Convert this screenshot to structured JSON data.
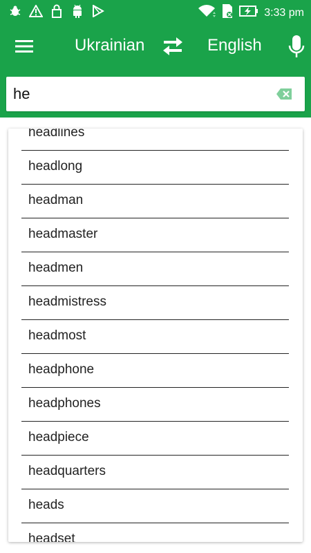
{
  "status_bar": {
    "time": "3:33 pm",
    "left_icons": [
      "bug-icon",
      "warning-triangle-icon",
      "lock-icon",
      "android-icon",
      "play-store-icon"
    ],
    "right_icons": [
      "wifi-icon",
      "sim-card-icon",
      "battery-charging-icon"
    ]
  },
  "toolbar": {
    "source_language": "Ukrainian",
    "target_language": "English"
  },
  "search": {
    "value": "he"
  },
  "suggestions": [
    "headlines",
    "headlong",
    "headman",
    "headmaster",
    "headmen",
    "headmistress",
    "headmost",
    "headphone",
    "headphones",
    "headpiece",
    "headquarters",
    "heads",
    "headset"
  ],
  "colors": {
    "primary": "#1aa34a",
    "text": "#222222",
    "clear_icon": "#7fcf9b"
  }
}
